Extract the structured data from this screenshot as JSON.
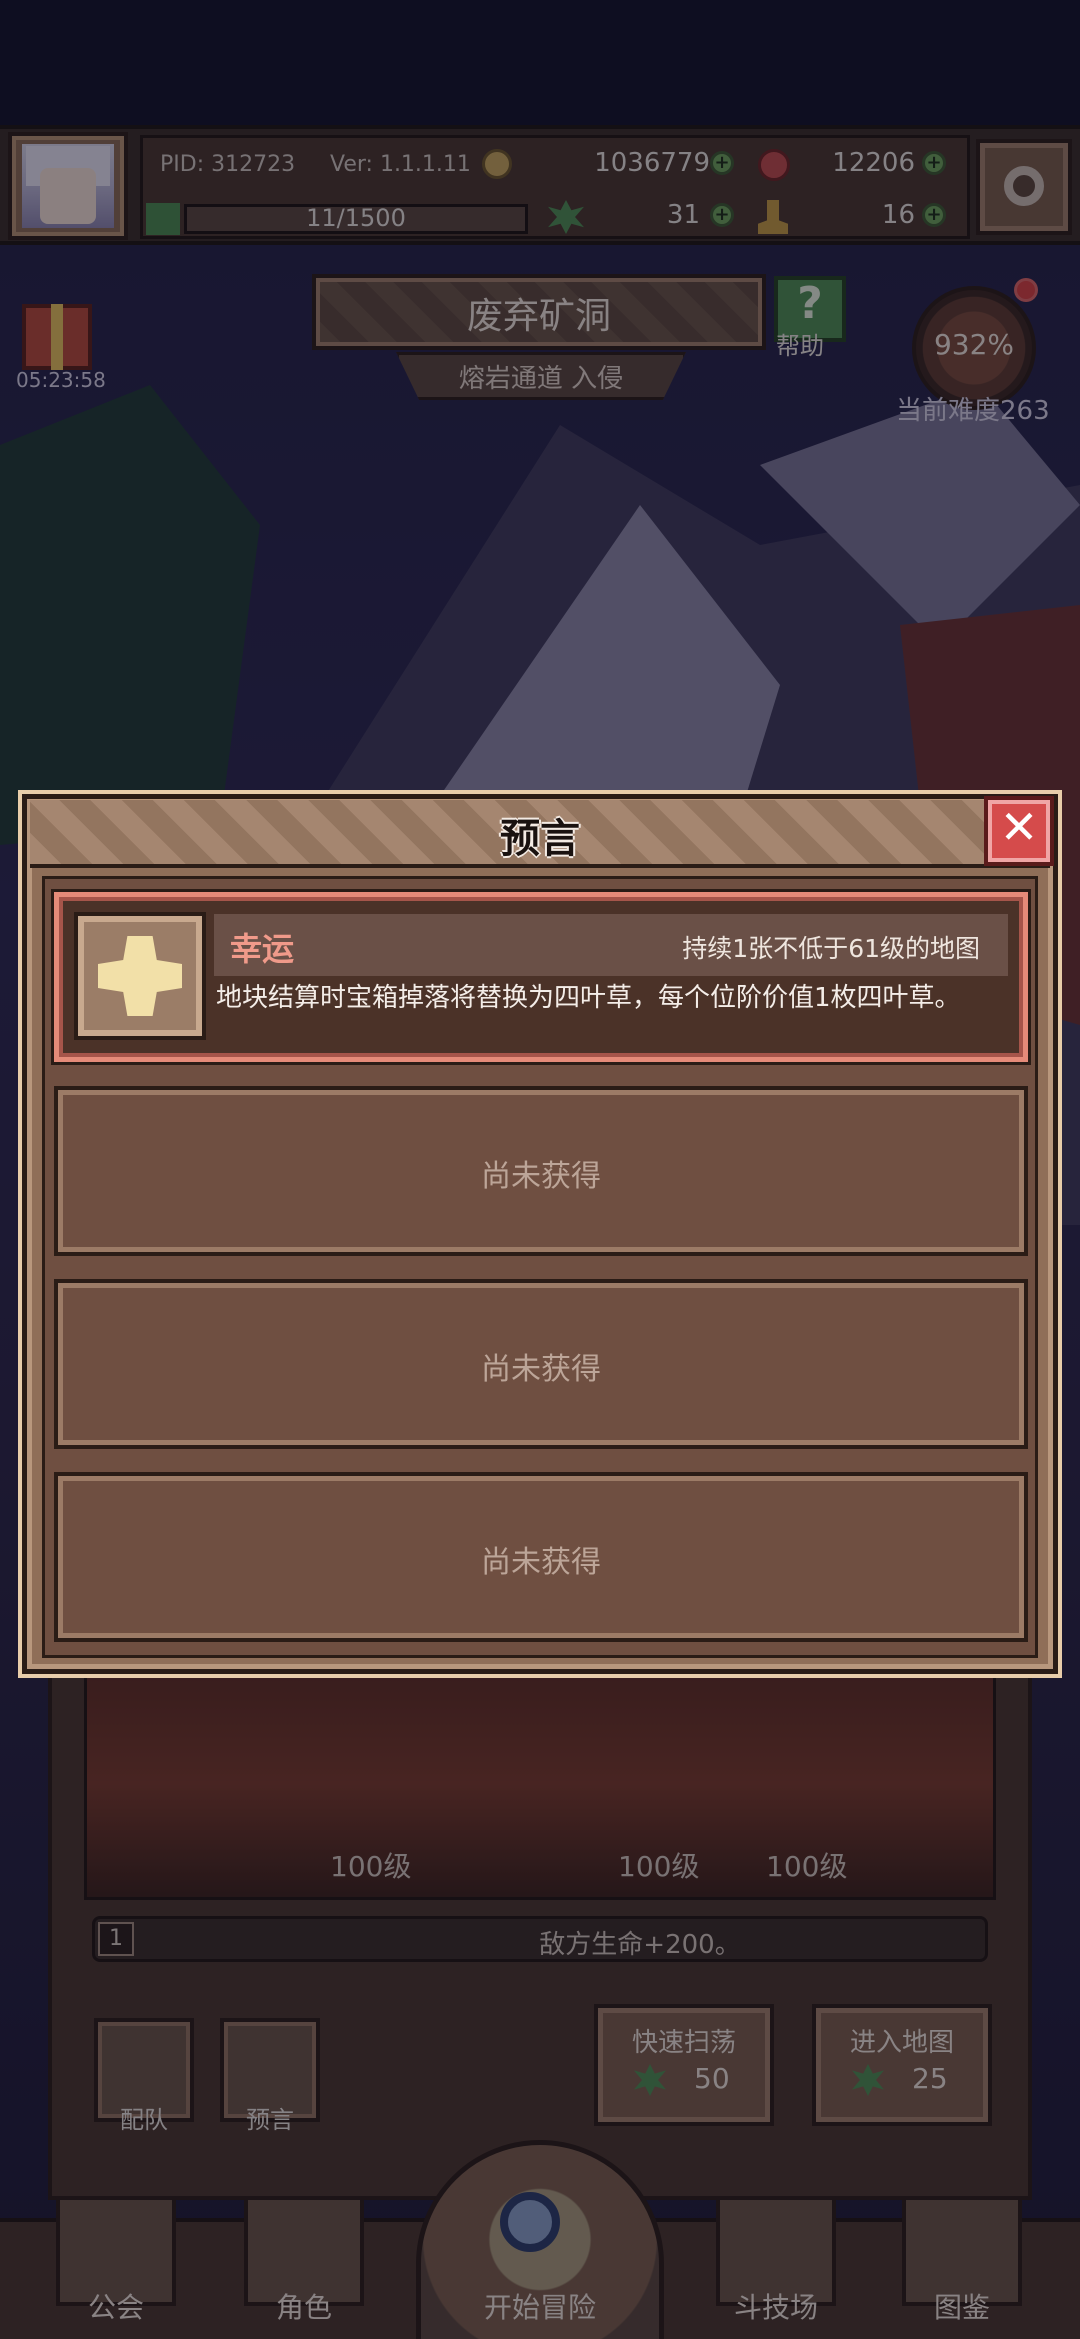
{
  "player": {
    "pid": "PID: 312723",
    "version": "Ver: 1.1.1.11",
    "gold": "1036779",
    "gems": "12206",
    "stamina": "11/1500",
    "clovers": "31",
    "boots": "16"
  },
  "gift": {
    "timer": "05:23:58"
  },
  "map": {
    "title": "废弃矿洞",
    "subtitle": "熔岩通道 入侵",
    "help_label": "帮助",
    "difficulty_pct": "932%",
    "difficulty_label": "当前难度263"
  },
  "dialog": {
    "title": "预言",
    "close_symbol": "✕",
    "active_card": {
      "name": "幸运",
      "condition": "持续1张不低于61级的地图",
      "description": "地块结算时宝箱掉落将替换为四叶草，每个位阶价值1枚四叶草。"
    },
    "empty_cards": [
      "尚未获得",
      "尚未获得",
      "尚未获得"
    ]
  },
  "stage": {
    "levels": [
      "100级",
      "100级",
      "100级"
    ],
    "enemy_index": "1",
    "enemy_effect": "敌方生命+200。",
    "team_label": "配队",
    "prophecy_label": "预言",
    "sweep_title": "快速扫荡",
    "sweep_cost": "50",
    "enter_title": "进入地图",
    "enter_cost": "25"
  },
  "nav": {
    "items": [
      "公会",
      "角色",
      "开始冒险",
      "斗技场",
      "图鉴"
    ]
  },
  "colors": {
    "accent_red": "#d54b4b",
    "accent_green": "#4f8f52",
    "card_highlight": "#e58b79"
  }
}
